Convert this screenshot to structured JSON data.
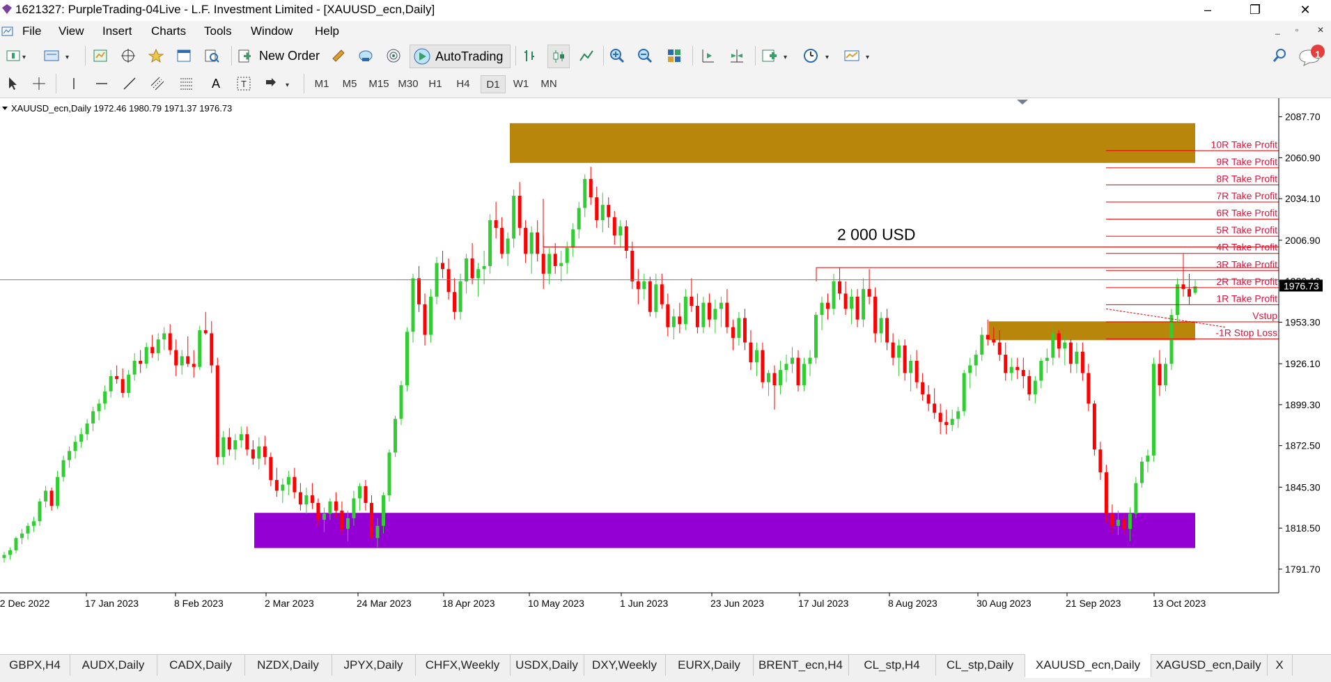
{
  "window": {
    "title": "1621327: PurpleTrading-04Live - L.F. Investment Limited - [XAUUSD_ecn,Daily]",
    "controls": {
      "minimize": "–",
      "maximize": "❐",
      "close": "✕"
    },
    "mdi_controls": {
      "minimize": "_",
      "restore": "▫",
      "close": "✕"
    }
  },
  "menu": [
    "File",
    "View",
    "Insert",
    "Charts",
    "Tools",
    "Window",
    "Help"
  ],
  "toolbar": {
    "new_order": "New Order",
    "autotrading": "AutoTrading",
    "notifications_count": "1",
    "icons": [
      "new-chart-icon",
      "profiles-icon",
      "market-watch-icon",
      "navigator-icon",
      "data-window-icon",
      "terminal-icon",
      "strategy-tester-icon",
      "new-order-icon",
      "metaeditor-icon",
      "signals-icon",
      "autotrading-icon",
      "bar-chart-icon",
      "candlestick-icon",
      "line-chart-icon",
      "zoom-in-icon",
      "zoom-out-icon",
      "tile-windows-icon",
      "chart-shift-icon",
      "auto-scroll-icon",
      "indicators-icon",
      "periods-icon",
      "templates-icon",
      "search-icon",
      "notifications-icon"
    ]
  },
  "timeframes": [
    "M1",
    "M5",
    "M15",
    "M30",
    "H1",
    "H4",
    "D1",
    "W1",
    "MN"
  ],
  "active_timeframe": "D1",
  "chart_data": {
    "type": "candlestick",
    "symbol_header": "XAUUSD_ecn,Daily  1972.46 1980.79 1971.37 1976.73",
    "current_price": "1976.73",
    "ylim": [
      1778,
      2098
    ],
    "y_ticks": [
      "2087.70",
      "2060.90",
      "2034.10",
      "2006.90",
      "1980.10",
      "1953.30",
      "1926.10",
      "1899.30",
      "1872.50",
      "1845.30",
      "1818.50",
      "1791.70"
    ],
    "x_ticks": [
      "22 Dec 2022",
      "17 Jan 2023",
      "8 Feb 2023",
      "2 Mar 2023",
      "24 Mar 2023",
      "18 Apr 2023",
      "10 May 2023",
      "1 Jun 2023",
      "23 Jun 2023",
      "17 Jul 2023",
      "8 Aug 2023",
      "30 Aug 2023",
      "21 Sep 2023",
      "13 Oct 2023"
    ],
    "annotation": "2 000 USD",
    "levels": [
      {
        "label": "10R Take Profit",
        "price": 2065.5
      },
      {
        "label": "9R Take Profit",
        "price": 2054.3
      },
      {
        "label": "8R Take Profit",
        "price": 2043.1
      },
      {
        "label": "7R Take Profit",
        "price": 2031.9
      },
      {
        "label": "6R Take Profit",
        "price": 2020.7
      },
      {
        "label": "5R Take Profit",
        "price": 2009.5
      },
      {
        "label": "4R Take Profit",
        "price": 1998.3
      },
      {
        "label": "3R Take Profit",
        "price": 1987.1
      },
      {
        "label": "2R Take Profit",
        "price": 1975.9
      },
      {
        "label": "1R Take Profit",
        "price": 1964.7
      },
      {
        "label": "Vstup",
        "price": 1953.5
      },
      {
        "label": "-1R Stop Loss",
        "price": 1942.3
      }
    ],
    "zones": [
      {
        "name": "resistance",
        "from": 2057.5,
        "to": 2083.5,
        "color": "#b8860b"
      },
      {
        "name": "entry",
        "from": 1941.5,
        "to": 1953.8,
        "color": "#b8860b"
      },
      {
        "name": "support",
        "from": 1805.5,
        "to": 1828.5,
        "color": "#9400d3"
      }
    ],
    "horizontal_lines": [
      {
        "name": "2000-usd-line",
        "price": 2002.5
      },
      {
        "name": "july-high-line",
        "price": 1989.0
      }
    ],
    "colors": {
      "bull": "#32cd32",
      "bear": "#ff0000",
      "level": "#e60000",
      "label": "#dc143c"
    },
    "candles": [
      [
        1799,
        1803,
        1796,
        1801
      ],
      [
        1801,
        1806,
        1798,
        1804
      ],
      [
        1804,
        1813,
        1802,
        1812
      ],
      [
        1812,
        1818,
        1808,
        1815
      ],
      [
        1815,
        1822,
        1811,
        1820
      ],
      [
        1820,
        1826,
        1816,
        1823
      ],
      [
        1823,
        1838,
        1820,
        1836
      ],
      [
        1836,
        1846,
        1832,
        1843
      ],
      [
        1843,
        1845,
        1830,
        1833
      ],
      [
        1833,
        1856,
        1831,
        1852
      ],
      [
        1852,
        1866,
        1849,
        1863
      ],
      [
        1863,
        1872,
        1858,
        1869
      ],
      [
        1869,
        1879,
        1864,
        1875
      ],
      [
        1875,
        1884,
        1871,
        1880
      ],
      [
        1880,
        1890,
        1876,
        1887
      ],
      [
        1887,
        1898,
        1882,
        1895
      ],
      [
        1895,
        1903,
        1889,
        1900
      ],
      [
        1900,
        1912,
        1896,
        1908
      ],
      [
        1908,
        1922,
        1904,
        1918
      ],
      [
        1918,
        1925,
        1913,
        1916
      ],
      [
        1916,
        1923,
        1904,
        1907
      ],
      [
        1907,
        1922,
        1904,
        1919
      ],
      [
        1919,
        1933,
        1915,
        1928
      ],
      [
        1928,
        1935,
        1920,
        1926
      ],
      [
        1926,
        1940,
        1923,
        1937
      ],
      [
        1937,
        1945,
        1930,
        1933
      ],
      [
        1933,
        1946,
        1928,
        1942
      ],
      [
        1942,
        1950,
        1935,
        1946
      ],
      [
        1946,
        1952,
        1932,
        1935
      ],
      [
        1935,
        1942,
        1918,
        1925
      ],
      [
        1925,
        1935,
        1919,
        1931
      ],
      [
        1931,
        1944,
        1924,
        1926
      ],
      [
        1926,
        1935,
        1917,
        1924
      ],
      [
        1924,
        1951,
        1922,
        1948
      ],
      [
        1948,
        1960,
        1945,
        1946
      ],
      [
        1946,
        1954,
        1920,
        1925
      ],
      [
        1925,
        1930,
        1860,
        1865
      ],
      [
        1865,
        1882,
        1860,
        1878
      ],
      [
        1878,
        1884,
        1866,
        1870
      ],
      [
        1870,
        1880,
        1863,
        1876
      ],
      [
        1876,
        1885,
        1871,
        1880
      ],
      [
        1880,
        1885,
        1866,
        1870
      ],
      [
        1870,
        1876,
        1860,
        1864
      ],
      [
        1864,
        1878,
        1857,
        1872
      ],
      [
        1872,
        1879,
        1860,
        1865
      ],
      [
        1865,
        1868,
        1846,
        1850
      ],
      [
        1850,
        1858,
        1839,
        1843
      ],
      [
        1843,
        1851,
        1835,
        1847
      ],
      [
        1847,
        1856,
        1840,
        1852
      ],
      [
        1852,
        1858,
        1838,
        1842
      ],
      [
        1842,
        1848,
        1830,
        1834
      ],
      [
        1834,
        1845,
        1828,
        1840
      ],
      [
        1840,
        1848,
        1831,
        1835
      ],
      [
        1835,
        1838,
        1820,
        1824
      ],
      [
        1824,
        1832,
        1816,
        1828
      ],
      [
        1828,
        1838,
        1824,
        1836
      ],
      [
        1836,
        1842,
        1825,
        1830
      ],
      [
        1830,
        1836,
        1814,
        1818
      ],
      [
        1818,
        1830,
        1810,
        1825
      ],
      [
        1825,
        1843,
        1820,
        1838
      ],
      [
        1838,
        1848,
        1830,
        1846
      ],
      [
        1846,
        1850,
        1830,
        1835
      ],
      [
        1835,
        1840,
        1808,
        1812
      ],
      [
        1812,
        1825,
        1806,
        1820
      ],
      [
        1820,
        1842,
        1815,
        1840
      ],
      [
        1840,
        1870,
        1836,
        1868
      ],
      [
        1868,
        1892,
        1865,
        1890
      ],
      [
        1890,
        1915,
        1886,
        1912
      ],
      [
        1912,
        1950,
        1908,
        1947
      ],
      [
        1947,
        1985,
        1940,
        1982
      ],
      [
        1982,
        1990,
        1960,
        1965
      ],
      [
        1965,
        1972,
        1938,
        1945
      ],
      [
        1945,
        1975,
        1940,
        1970
      ],
      [
        1970,
        1996,
        1965,
        1992
      ],
      [
        1992,
        2000,
        1982,
        1988
      ],
      [
        1988,
        1995,
        1968,
        1973
      ],
      [
        1973,
        1982,
        1955,
        1960
      ],
      [
        1960,
        1985,
        1955,
        1980
      ],
      [
        1980,
        1998,
        1972,
        1995
      ],
      [
        1995,
        2005,
        1978,
        1982
      ],
      [
        1982,
        1992,
        1970,
        1988
      ],
      [
        1988,
        2000,
        1978,
        1990
      ],
      [
        1990,
        2024,
        1985,
        2020
      ],
      [
        2020,
        2032,
        2008,
        2015
      ],
      [
        2015,
        2022,
        1995,
        1998
      ],
      [
        1998,
        2012,
        1990,
        2008
      ],
      [
        2008,
        2040,
        2002,
        2036
      ],
      [
        2036,
        2045,
        2010,
        2015
      ],
      [
        2015,
        2020,
        1992,
        1998
      ],
      [
        1998,
        2016,
        1985,
        2012
      ],
      [
        2012,
        2020,
        1993,
        1998
      ],
      [
        1998,
        2010,
        1975,
        1985
      ],
      [
        1985,
        2002,
        1978,
        1998
      ],
      [
        1998,
        2005,
        1985,
        1990
      ],
      [
        1990,
        2000,
        1980,
        1992
      ],
      [
        1992,
        2006,
        1985,
        2002
      ],
      [
        2002,
        2018,
        1996,
        2014
      ],
      [
        2014,
        2032,
        2008,
        2028
      ],
      [
        2028,
        2050,
        2022,
        2047
      ],
      [
        2047,
        2055,
        2030,
        2035
      ],
      [
        2035,
        2042,
        2015,
        2020
      ],
      [
        2020,
        2038,
        2012,
        2030
      ],
      [
        2030,
        2035,
        2015,
        2022
      ],
      [
        2022,
        2026,
        2004,
        2010
      ],
      [
        2010,
        2020,
        2002,
        2016
      ],
      [
        2016,
        2020,
        1995,
        2000
      ],
      [
        2000,
        2006,
        1975,
        1980
      ],
      [
        1980,
        1988,
        1965,
        1975
      ],
      [
        1975,
        1985,
        1968,
        1980
      ],
      [
        1980,
        1983,
        1957,
        1960
      ],
      [
        1960,
        1985,
        1956,
        1978
      ],
      [
        1978,
        1985,
        1962,
        1965
      ],
      [
        1965,
        1972,
        1944,
        1950
      ],
      [
        1950,
        1962,
        1942,
        1957
      ],
      [
        1957,
        1966,
        1946,
        1952
      ],
      [
        1952,
        1975,
        1948,
        1970
      ],
      [
        1970,
        1982,
        1960,
        1964
      ],
      [
        1964,
        1972,
        1946,
        1950
      ],
      [
        1950,
        1970,
        1946,
        1966
      ],
      [
        1966,
        1972,
        1950,
        1955
      ],
      [
        1955,
        1968,
        1946,
        1962
      ],
      [
        1962,
        1970,
        1950,
        1966
      ],
      [
        1966,
        1975,
        1946,
        1950
      ],
      [
        1950,
        1955,
        1935,
        1943
      ],
      [
        1943,
        1960,
        1938,
        1956
      ],
      [
        1956,
        1962,
        1935,
        1940
      ],
      [
        1940,
        1948,
        1922,
        1927
      ],
      [
        1927,
        1940,
        1918,
        1935
      ],
      [
        1935,
        1940,
        1910,
        1914
      ],
      [
        1914,
        1922,
        1905,
        1920
      ],
      [
        1920,
        1925,
        1896,
        1912
      ],
      [
        1912,
        1928,
        1906,
        1922
      ],
      [
        1922,
        1932,
        1914,
        1926
      ],
      [
        1926,
        1937,
        1920,
        1930
      ],
      [
        1930,
        1935,
        1908,
        1912
      ],
      [
        1912,
        1930,
        1908,
        1926
      ],
      [
        1926,
        1935,
        1918,
        1930
      ],
      [
        1930,
        1960,
        1926,
        1958
      ],
      [
        1958,
        1970,
        1948,
        1966
      ],
      [
        1966,
        1972,
        1955,
        1962
      ],
      [
        1962,
        1985,
        1958,
        1980
      ],
      [
        1980,
        1989,
        1968,
        1972
      ],
      [
        1972,
        1980,
        1958,
        1962
      ],
      [
        1962,
        1975,
        1952,
        1970
      ],
      [
        1970,
        1975,
        1950,
        1955
      ],
      [
        1955,
        1982,
        1950,
        1975
      ],
      [
        1975,
        1988,
        1965,
        1970
      ],
      [
        1970,
        1976,
        1940,
        1946
      ],
      [
        1946,
        1960,
        1940,
        1956
      ],
      [
        1956,
        1962,
        1935,
        1940
      ],
      [
        1940,
        1946,
        1925,
        1930
      ],
      [
        1930,
        1942,
        1918,
        1938
      ],
      [
        1938,
        1942,
        1915,
        1920
      ],
      [
        1920,
        1932,
        1908,
        1928
      ],
      [
        1928,
        1935,
        1910,
        1914
      ],
      [
        1914,
        1920,
        1902,
        1906
      ],
      [
        1906,
        1912,
        1895,
        1900
      ],
      [
        1900,
        1910,
        1890,
        1894
      ],
      [
        1894,
        1900,
        1880,
        1888
      ],
      [
        1888,
        1896,
        1880,
        1886
      ],
      [
        1886,
        1896,
        1882,
        1890
      ],
      [
        1890,
        1898,
        1884,
        1895
      ],
      [
        1895,
        1922,
        1892,
        1920
      ],
      [
        1920,
        1930,
        1910,
        1925
      ],
      [
        1925,
        1935,
        1918,
        1932
      ],
      [
        1932,
        1950,
        1928,
        1945
      ],
      [
        1945,
        1955,
        1938,
        1942
      ],
      [
        1942,
        1950,
        1938,
        1940
      ],
      [
        1940,
        1948,
        1928,
        1932
      ],
      [
        1932,
        1940,
        1915,
        1920
      ],
      [
        1920,
        1930,
        1915,
        1924
      ],
      [
        1924,
        1930,
        1916,
        1922
      ],
      [
        1922,
        1930,
        1910,
        1918
      ],
      [
        1918,
        1922,
        1902,
        1906
      ],
      [
        1906,
        1918,
        1900,
        1915
      ],
      [
        1915,
        1930,
        1910,
        1928
      ],
      [
        1928,
        1936,
        1920,
        1930
      ],
      [
        1930,
        1950,
        1925,
        1946
      ],
      [
        1946,
        1948,
        1930,
        1936
      ],
      [
        1936,
        1945,
        1925,
        1940
      ],
      [
        1940,
        1942,
        1920,
        1926
      ],
      [
        1926,
        1940,
        1920,
        1934
      ],
      [
        1934,
        1940,
        1915,
        1920
      ],
      [
        1920,
        1926,
        1895,
        1900
      ],
      [
        1900,
        1902,
        1866,
        1870
      ],
      [
        1870,
        1875,
        1850,
        1855
      ],
      [
        1855,
        1860,
        1822,
        1828
      ],
      [
        1828,
        1834,
        1815,
        1820
      ],
      [
        1820,
        1830,
        1814,
        1824
      ],
      [
        1824,
        1828,
        1814,
        1818
      ],
      [
        1818,
        1832,
        1810,
        1828
      ],
      [
        1828,
        1852,
        1825,
        1848
      ],
      [
        1848,
        1865,
        1845,
        1862
      ],
      [
        1862,
        1870,
        1855,
        1866
      ],
      [
        1866,
        1930,
        1862,
        1926
      ],
      [
        1926,
        1935,
        1905,
        1912
      ],
      [
        1912,
        1930,
        1908,
        1926
      ],
      [
        1926,
        1962,
        1922,
        1958
      ],
      [
        1958,
        1982,
        1952,
        1978
      ],
      [
        1978,
        1998,
        1970,
        1975
      ],
      [
        1975,
        1985,
        1965,
        1970
      ],
      [
        1972.46,
        1980.79,
        1971.37,
        1976.73
      ]
    ]
  },
  "tabs": [
    "GBPX,H4",
    "AUDX,Daily",
    "CADX,Daily",
    "NZDX,Daily",
    "JPYX,Daily",
    "CHFX,Weekly",
    "USDX,Daily",
    "DXY,Weekly",
    "EURX,Daily",
    "BRENT_ecn,H4",
    "CL_stp,H4",
    "CL_stp,Daily",
    "XAUUSD_ecn,Daily",
    "XAGUSD_ecn,Daily",
    "X"
  ],
  "active_tab": "XAUUSD_ecn,Daily"
}
